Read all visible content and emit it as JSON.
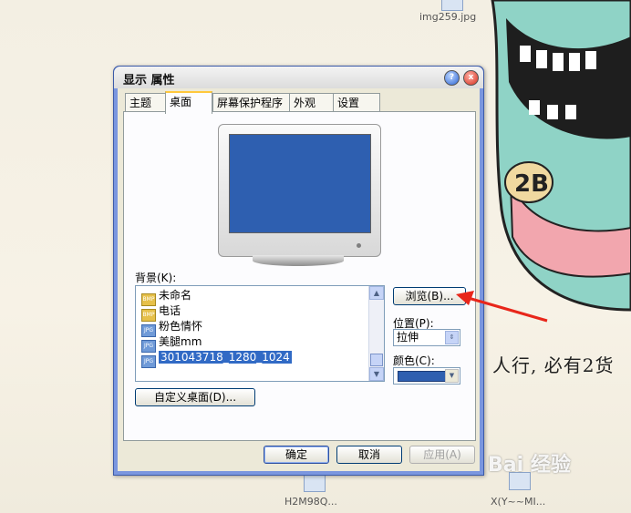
{
  "desktop": {
    "icon_label_top": "img259.jpg",
    "icon_label_bottom_left": "H2M98Q...",
    "icon_label_bottom_right": "X(Y~~MI...",
    "handwriting": "人行, 必有2货",
    "badge_text": "2B",
    "watermark": "Bai 经验"
  },
  "window": {
    "title": "显示 属性",
    "help_glyph": "?",
    "close_glyph": "x"
  },
  "tabs": [
    {
      "label": "主题"
    },
    {
      "label": "桌面"
    },
    {
      "label": "屏幕保护程序"
    },
    {
      "label": "外观"
    },
    {
      "label": "设置"
    }
  ],
  "desktop_tab": {
    "background_label": "背景(K):",
    "backgrounds": [
      {
        "icon": "BMP",
        "label": "未命名"
      },
      {
        "icon": "BMP",
        "label": "电话"
      },
      {
        "icon": "JPG",
        "label": "粉色情怀"
      },
      {
        "icon": "JPG",
        "label": "美腿mm"
      },
      {
        "icon": "JPG",
        "label": "301043718_1280_1024"
      }
    ],
    "browse_button": "浏览(B)...",
    "position_label": "位置(P):",
    "position_value": "拉伸",
    "color_label": "颜色(C):",
    "color_value": "#2e5fb0",
    "customize_button": "自定义桌面(D)..."
  },
  "footer": {
    "ok": "确定",
    "cancel": "取消",
    "apply": "应用(A)"
  },
  "colors": {
    "xp_blue": "#316ac5",
    "selected_bg_preview": "#2e5fb0",
    "annotation_arrow": "#e8261a"
  }
}
